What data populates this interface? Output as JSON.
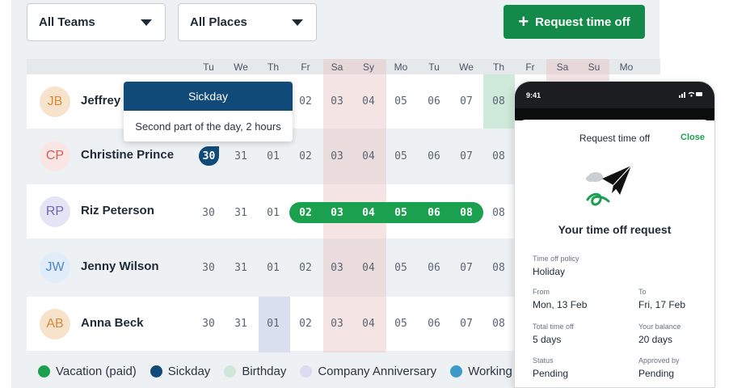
{
  "filters": {
    "teams": "All Teams",
    "places": "All Places"
  },
  "request_button": {
    "plus": "+",
    "label": "Request time off"
  },
  "days": [
    "Tu",
    "We",
    "Th",
    "Fr",
    "Sa",
    "Sy",
    "Mo",
    "Tu",
    "We",
    "Th",
    "Fr",
    "Sa",
    "Su",
    "Mo"
  ],
  "dates": [
    "30",
    "31",
    "01",
    "02",
    "03",
    "04",
    "05",
    "06",
    "07",
    "08"
  ],
  "people": [
    {
      "initials": "JB",
      "name": "Jeffrey",
      "avatar_bg": "#f7e3cc",
      "avatar_fg": "#d48a3e"
    },
    {
      "initials": "CP",
      "name": "Christine Prince",
      "avatar_bg": "#fbe6e6",
      "avatar_fg": "#d65a5a"
    },
    {
      "initials": "RP",
      "name": "Riz Peterson",
      "avatar_bg": "#e5e4f5",
      "avatar_fg": "#6c67b8"
    },
    {
      "initials": "JW",
      "name": "Jenny Wilson",
      "avatar_bg": "#e1ecf9",
      "avatar_fg": "#4f86c6"
    },
    {
      "initials": "AB",
      "name": "Anna Beck",
      "avatar_bg": "#f7e3cc",
      "avatar_fg": "#d48a3e"
    }
  ],
  "tooltip": {
    "title": "Sickday",
    "text": "Second part of the day, 2 hours"
  },
  "legend": [
    {
      "label": "Vacation (paid)",
      "color": "#1aa04f"
    },
    {
      "label": "Sickday",
      "color": "#0f4a78"
    },
    {
      "label": "Birthday",
      "color": "#cfe6d8"
    },
    {
      "label": "Company Anniversary",
      "color": "#d9dcef"
    },
    {
      "label": "Working",
      "color": "#3d9ac8"
    }
  ],
  "phone": {
    "time": "9:41",
    "status_icons": "signal-wifi-battery-icons",
    "title": "Request time off",
    "close": "Close",
    "heading": "Your time off request",
    "fields": {
      "policy_label": "Time off policy",
      "policy_value": "Holiday",
      "from_label": "From",
      "from_value": "Mon, 13 Feb",
      "to_label": "To",
      "to_value": "Fri, 17 Feb",
      "total_label": "Total time off",
      "total_value": "5 days",
      "balance_label": "Your balance",
      "balance_value": "20 days",
      "status_label": "Status",
      "status_value": "Pending",
      "approved_label": "Approved by",
      "approved_value": "Pending"
    }
  },
  "colors": {
    "accent": "#138a4a",
    "sickday": "#0f4a78",
    "weekend": "#e7c3c3",
    "birthday": "#cfe9da",
    "anniversary": "#dadff0"
  }
}
